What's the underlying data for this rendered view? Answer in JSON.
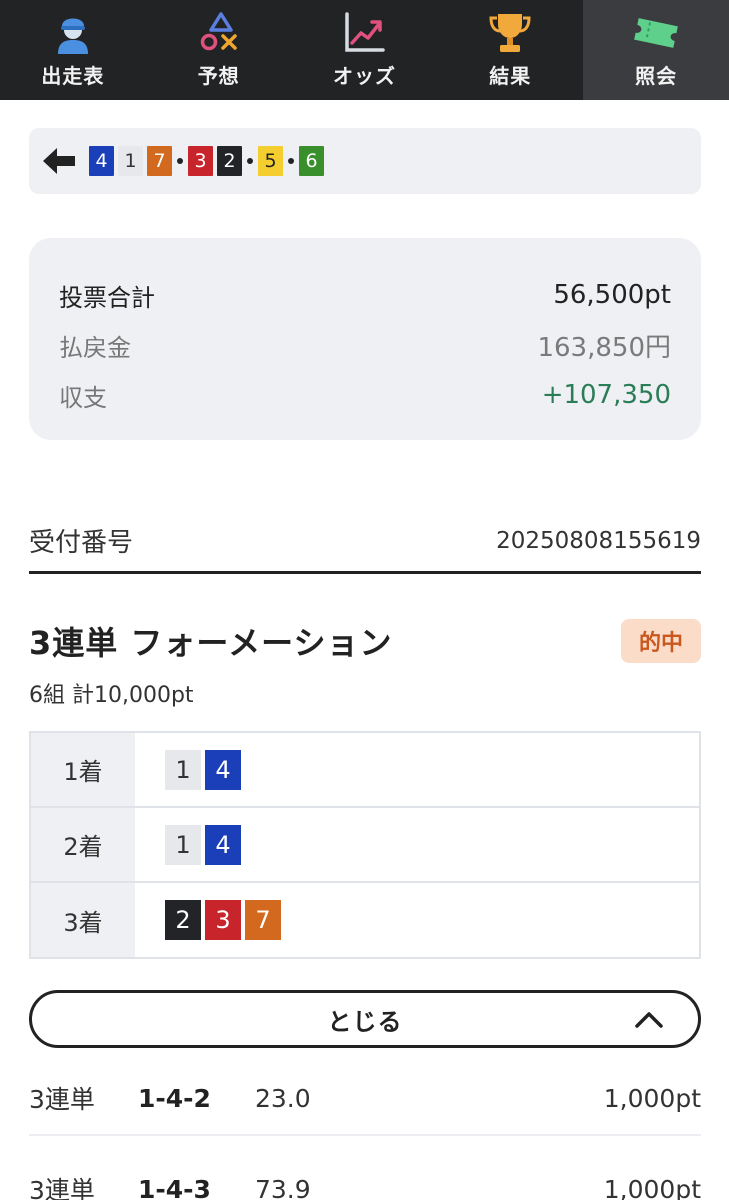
{
  "nav": {
    "items": [
      {
        "label": "出走表",
        "icon": "jockey-icon"
      },
      {
        "label": "予想",
        "icon": "shapes-icon"
      },
      {
        "label": "オッズ",
        "icon": "trend-chart-icon"
      },
      {
        "label": "結果",
        "icon": "trophy-icon"
      },
      {
        "label": "照会",
        "icon": "ticket-icon"
      }
    ],
    "active_index": 4
  },
  "result_order": [
    "4",
    "1",
    "7",
    "3",
    "2",
    "5",
    "6"
  ],
  "summary": {
    "total_label": "投票合計",
    "total_value": "56,500pt",
    "payout_label": "払戻金",
    "payout_value": "163,850円",
    "balance_label": "収支",
    "balance_value": "+107,350"
  },
  "receipt": {
    "label": "受付番号",
    "value": "20250808155619"
  },
  "bet": {
    "title": "3連単 フォーメーション",
    "badge": "的中",
    "subtitle": "6組 計10,000pt",
    "formation": [
      {
        "label": "1着",
        "numbers": [
          "1",
          "4"
        ]
      },
      {
        "label": "2着",
        "numbers": [
          "1",
          "4"
        ]
      },
      {
        "label": "3着",
        "numbers": [
          "2",
          "3",
          "7"
        ]
      }
    ],
    "close_label": "とじる"
  },
  "bet_lines": [
    {
      "type": "3連単",
      "combo": "1-4-2",
      "odds": "23.0",
      "amount": "1,000pt"
    },
    {
      "type": "3連単",
      "combo": "1-4-3",
      "odds": "73.9",
      "amount": "1,000pt"
    }
  ],
  "colors": {
    "nav_bg": "#222325",
    "profit": "#2a7d57",
    "hit_badge_bg": "#fbdcc8",
    "hit_badge_text": "#c9571e",
    "horse_1": "#e6e8ec",
    "horse_2": "#222428",
    "horse_3": "#c8242b",
    "horse_4": "#1a3fb8",
    "horse_5": "#f4cd2e",
    "horse_6": "#3a8f2d",
    "horse_7": "#d2691e"
  }
}
